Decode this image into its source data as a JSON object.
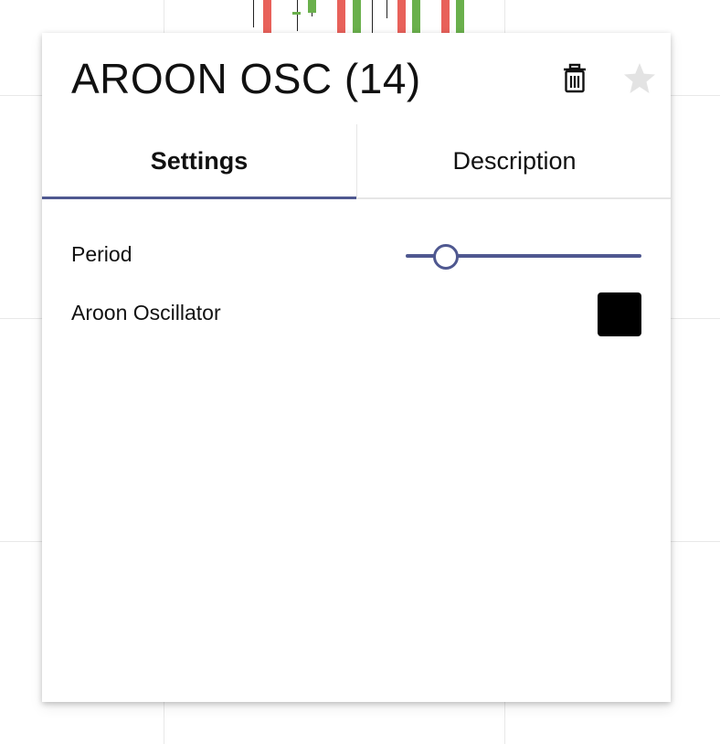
{
  "indicator": {
    "title": "AROON OSC (14)",
    "tabs": [
      {
        "label": "Settings",
        "active": true
      },
      {
        "label": "Description",
        "active": false
      }
    ],
    "settings": {
      "period": {
        "label": "Period",
        "value": 14
      },
      "oscillator": {
        "label": "Aroon Oscillator",
        "color": "#000000"
      }
    }
  },
  "colors": {
    "accent": "#4f5890",
    "candle_up": "#6ab04c",
    "candle_down": "#e8615a",
    "star": "#e3e3e3"
  },
  "icons": [
    "trash-icon",
    "star-icon"
  ]
}
